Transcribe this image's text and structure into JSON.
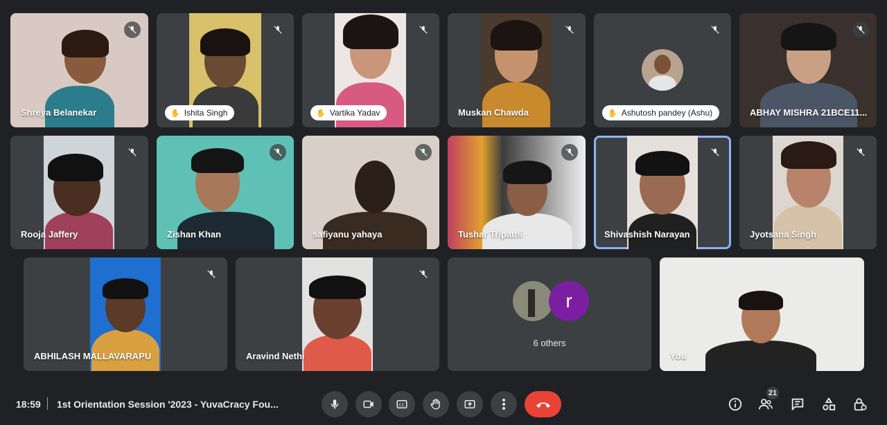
{
  "participants": [
    {
      "name": "Shreya Belanekar",
      "chip": false
    },
    {
      "name": "Ishita Singh",
      "chip": true
    },
    {
      "name": "Vartika Yadav",
      "chip": true
    },
    {
      "name": "Muskan Chawda",
      "chip": false
    },
    {
      "name": "Ashutosh pandey (Ashu)",
      "chip": true
    },
    {
      "name": "ABHAY MISHRA 21BCE11...",
      "chip": false
    },
    {
      "name": "Rooja Jaffery",
      "chip": false
    },
    {
      "name": "Zishan Khan",
      "chip": false
    },
    {
      "name": "safiyanu yahaya",
      "chip": false
    },
    {
      "name": "Tushar Tripathi",
      "chip": false
    },
    {
      "name": "Shivashish Narayan",
      "chip": false
    },
    {
      "name": "Jyotsana Singh",
      "chip": false
    },
    {
      "name": "ABHILASH MALLAVARAPU",
      "chip": false
    },
    {
      "name": "Aravind Nethi",
      "chip": false
    }
  ],
  "others_tile": {
    "avatar_letter": "r",
    "label": "6 others",
    "avatar_color": "#7b1fa2"
  },
  "self_tile": {
    "name": "You"
  },
  "bottom_bar": {
    "time": "18:59",
    "meeting_title": "1st Orientation Session '2023 - YuvaCracy Fou...",
    "people_count": "21",
    "icons": [
      "microphone-icon",
      "camera-icon",
      "captions-icon",
      "raise-hand-icon",
      "present-icon",
      "more-options-icon",
      "end-call-icon",
      "info-icon",
      "people-icon",
      "chat-icon",
      "activities-icon",
      "host-controls-icon"
    ]
  },
  "colors": {
    "background": "#202124",
    "tile": "#3c4043",
    "end_call": "#ea4335",
    "active_border": "#8ab4f8"
  }
}
